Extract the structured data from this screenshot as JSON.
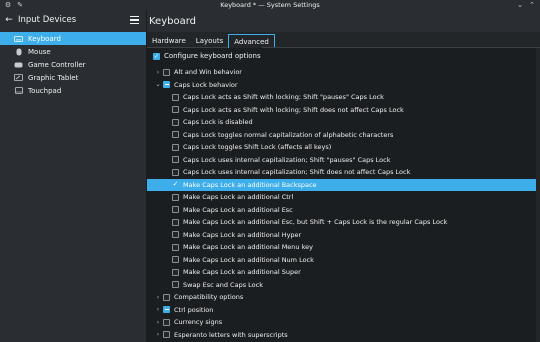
{
  "window": {
    "title": "Keyboard * — System Settings"
  },
  "sidebar": {
    "title": "Input Devices",
    "items": [
      {
        "label": "Keyboard",
        "icon": "keyboard-icon",
        "active": true
      },
      {
        "label": "Mouse",
        "icon": "mouse-icon",
        "active": false
      },
      {
        "label": "Game Controller",
        "icon": "gamepad-icon",
        "active": false
      },
      {
        "label": "Graphic Tablet",
        "icon": "tablet-icon",
        "active": false
      },
      {
        "label": "Touchpad",
        "icon": "touchpad-icon",
        "active": false
      }
    ]
  },
  "main": {
    "title": "Keyboard",
    "tabs": [
      {
        "label": "Hardware"
      },
      {
        "label": "Layouts"
      },
      {
        "label": "Advanced"
      }
    ],
    "configure_label": "Configure keyboard options"
  },
  "options": [
    {
      "label": "Alt and Win behavior",
      "level": 0,
      "expander": "›",
      "state": "unchecked"
    },
    {
      "label": "Caps Lock behavior",
      "level": 0,
      "expander": "⌄",
      "state": "partial"
    },
    {
      "label": "Caps Lock acts as Shift with locking; Shift \"pauses\" Caps Lock",
      "level": 1,
      "state": "unchecked"
    },
    {
      "label": "Caps Lock acts as Shift with locking; Shift does not affect Caps Lock",
      "level": 1,
      "state": "unchecked"
    },
    {
      "label": "Caps Lock is disabled",
      "level": 1,
      "state": "unchecked"
    },
    {
      "label": "Caps Lock toggles normal capitalization of alphabetic characters",
      "level": 1,
      "state": "unchecked"
    },
    {
      "label": "Caps Lock toggles Shift Lock (affects all keys)",
      "level": 1,
      "state": "unchecked"
    },
    {
      "label": "Caps Lock uses internal capitalization; Shift \"pauses\" Caps Lock",
      "level": 1,
      "state": "unchecked"
    },
    {
      "label": "Caps Lock uses internal capitalization; Shift does not affect Caps Lock",
      "level": 1,
      "state": "unchecked"
    },
    {
      "label": "Make Caps Lock an additional Backspace",
      "level": 1,
      "state": "checked",
      "selected": true
    },
    {
      "label": "Make Caps Lock an additional Ctrl",
      "level": 1,
      "state": "unchecked"
    },
    {
      "label": "Make Caps Lock an additional Esc",
      "level": 1,
      "state": "unchecked"
    },
    {
      "label": "Make Caps Lock an additional Esc, but Shift + Caps Lock is the regular Caps Lock",
      "level": 1,
      "state": "unchecked"
    },
    {
      "label": "Make Caps Lock an additional Hyper",
      "level": 1,
      "state": "unchecked"
    },
    {
      "label": "Make Caps Lock an additional Menu key",
      "level": 1,
      "state": "unchecked"
    },
    {
      "label": "Make Caps Lock an additional Num Lock",
      "level": 1,
      "state": "unchecked"
    },
    {
      "label": "Make Caps Lock an additional Super",
      "level": 1,
      "state": "unchecked"
    },
    {
      "label": "Swap Esc and Caps Lock",
      "level": 1,
      "state": "unchecked"
    },
    {
      "label": "Compatibility options",
      "level": 0,
      "expander": "›",
      "state": "unchecked"
    },
    {
      "label": "Ctrl position",
      "level": 0,
      "expander": "›",
      "state": "partial"
    },
    {
      "label": "Currency signs",
      "level": 0,
      "expander": "›",
      "state": "unchecked"
    },
    {
      "label": "Esperanto letters with superscripts",
      "level": 0,
      "expander": "›",
      "state": "unchecked"
    }
  ],
  "colors": {
    "accent": "#3daee9",
    "background": "#1b1e20",
    "panel": "#2a2e32"
  }
}
